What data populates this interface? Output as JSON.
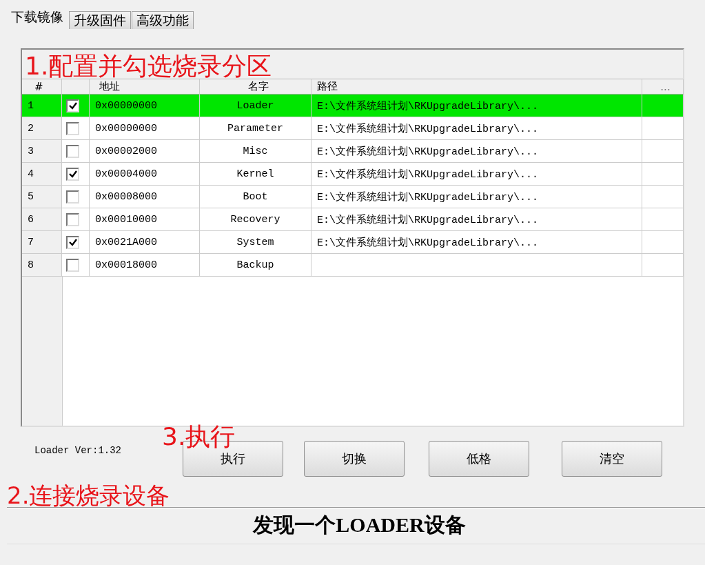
{
  "tabs": [
    {
      "label": "下载镜像",
      "selected": true
    },
    {
      "label": "升级固件",
      "selected": false
    },
    {
      "label": "高级功能",
      "selected": false
    }
  ],
  "table": {
    "annotation": "1.配置并勾选烧录分区",
    "columns": [
      "#",
      "地址",
      "名字",
      "路径",
      "..."
    ],
    "rows": [
      {
        "num": "1",
        "checked": true,
        "address": "0x00000000",
        "name": "Loader",
        "path": "E:\\文件系统组计划\\RKUpgradeLibrary\\...",
        "selected": true
      },
      {
        "num": "2",
        "checked": false,
        "address": "0x00000000",
        "name": "Parameter",
        "path": "E:\\文件系统组计划\\RKUpgradeLibrary\\...",
        "selected": false
      },
      {
        "num": "3",
        "checked": false,
        "address": "0x00002000",
        "name": "Misc",
        "path": "E:\\文件系统组计划\\RKUpgradeLibrary\\...",
        "selected": false
      },
      {
        "num": "4",
        "checked": true,
        "address": "0x00004000",
        "name": "Kernel",
        "path": "E:\\文件系统组计划\\RKUpgradeLibrary\\...",
        "selected": false
      },
      {
        "num": "5",
        "checked": false,
        "address": "0x00008000",
        "name": "Boot",
        "path": "E:\\文件系统组计划\\RKUpgradeLibrary\\...",
        "selected": false
      },
      {
        "num": "6",
        "checked": false,
        "address": "0x00010000",
        "name": "Recovery",
        "path": "E:\\文件系统组计划\\RKUpgradeLibrary\\...",
        "selected": false
      },
      {
        "num": "7",
        "checked": true,
        "address": "0x0021A000",
        "name": "System",
        "path": "E:\\文件系统组计划\\RKUpgradeLibrary\\...",
        "selected": false
      },
      {
        "num": "8",
        "checked": false,
        "address": "0x00018000",
        "name": "Backup",
        "selected": false
      }
    ]
  },
  "loader_version": "Loader Ver:1.32",
  "buttons_annotation": "3.执行",
  "buttons": [
    "执行",
    "切换",
    "低格",
    "清空"
  ],
  "status": {
    "annotation": "2.连接烧录设备",
    "text": "发现一个LOADER设备"
  }
}
